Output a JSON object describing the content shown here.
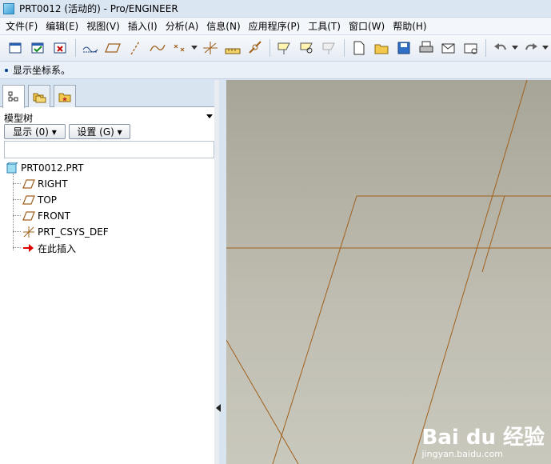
{
  "window": {
    "title": "PRT0012 (活动的) - Pro/ENGINEER"
  },
  "menu": [
    "文件(F)",
    "编辑(E)",
    "视图(V)",
    "插入(I)",
    "分析(A)",
    "信息(N)",
    "应用程序(P)",
    "工具(T)",
    "窗口(W)",
    "帮助(H)"
  ],
  "status": {
    "message": "显示坐标系。"
  },
  "model_tree": {
    "title": "模型树",
    "show_button": "显示 (0) ▾",
    "settings_button": "设置 (G) ▾",
    "filter_value": "",
    "items": [
      "PRT0012.PRT",
      "RIGHT",
      "TOP",
      "FRONT",
      "PRT_CSYS_DEF",
      "在此插入"
    ]
  },
  "watermark": {
    "logo": "Bai du 经验",
    "sub": "jingyan.baidu.com"
  },
  "colors": {
    "datum_plane": "#a0601c",
    "viewport_top": "#a7a597",
    "viewport_bottom": "#c9c8bd",
    "insert_arrow": "#e00000"
  }
}
